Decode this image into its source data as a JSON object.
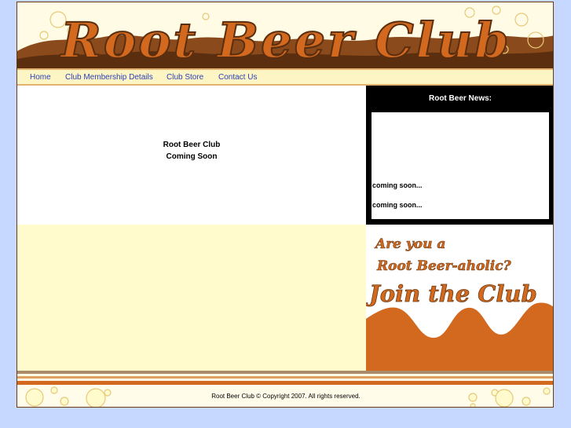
{
  "site": {
    "logo_text": "Root Beer Club"
  },
  "nav": {
    "items": [
      {
        "label": "Home"
      },
      {
        "label": "Club Membership Details"
      },
      {
        "label": "Club Store"
      },
      {
        "label": "Contact Us"
      }
    ]
  },
  "main": {
    "line1": "Root Beer Club",
    "line2": "Coming Soon"
  },
  "news": {
    "title": "Root Beer News:",
    "items": [
      "coming soon...",
      "coming soon..."
    ]
  },
  "promo": {
    "line1": "Are you a",
    "line2": "Root Beer-aholic?",
    "line3": "Join the Club"
  },
  "footer": {
    "copyright": "Root Beer Club © Copyright 2007.   All rights reserved."
  },
  "colors": {
    "page_background": "#c6d8ff",
    "brand_orange": "#d2691e",
    "brand_brown": "#6b3a12",
    "cream": "#fffbcd",
    "news_background": "#000000",
    "nav_link": "#2a3fb8"
  }
}
